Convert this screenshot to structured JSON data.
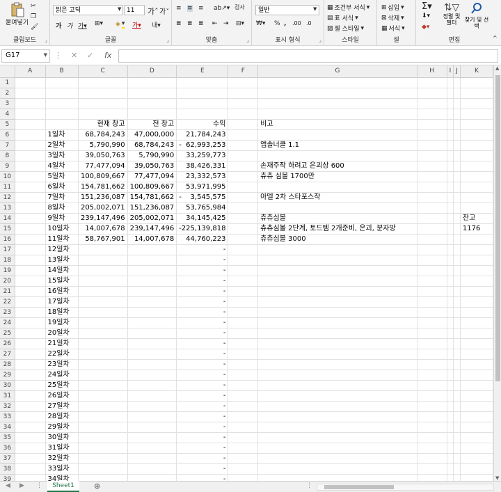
{
  "ribbon": {
    "clipboard": {
      "paste": "붙여넣기",
      "label": "클립보드"
    },
    "font": {
      "name": "맑은 고딕",
      "size": "11",
      "label": "글꼴"
    },
    "alignment": {
      "label": "맞춤",
      "wrap": "검사"
    },
    "number": {
      "format": "일반",
      "label": "표시 형식"
    },
    "styles": {
      "conditional": "조건부 서식",
      "table": "표 서식",
      "cell": "셀 스타일",
      "label": "스타일"
    },
    "cells": {
      "insert": "삽입",
      "delete": "삭제",
      "format": "서식",
      "label": "셀"
    },
    "editing": {
      "sort_filter": "정렬 및 필터",
      "find_select": "찾기 및 선택",
      "label": "편집"
    }
  },
  "formula_bar": {
    "name_box": "G17",
    "formula": ""
  },
  "columns": [
    "A",
    "B",
    "C",
    "D",
    "E",
    "F",
    "G",
    "H",
    "I",
    "J",
    "K"
  ],
  "rows": [
    {
      "n": "1"
    },
    {
      "n": "2"
    },
    {
      "n": "3"
    },
    {
      "n": "4"
    },
    {
      "n": "5",
      "c": "현재 창고",
      "d": "전 창고",
      "e": "수익",
      "g": "비고"
    },
    {
      "n": "6",
      "b": "1일차",
      "c": "68,784,243",
      "d": "47,000,000",
      "e": "21,784,243"
    },
    {
      "n": "7",
      "b": "2일차",
      "c": "5,790,990",
      "d": "68,784,243",
      "e_neg": "-",
      "e": "62,993,253",
      "g": "앱솔너클 1.1"
    },
    {
      "n": "8",
      "b": "3일차",
      "c": "39,050,763",
      "d": "5,790,990",
      "e": "33,259,773"
    },
    {
      "n": "9",
      "b": "4일차",
      "c": "77,477,094",
      "d": "39,050,763",
      "e": "38,426,331",
      "g": "손재주작 하려고 은괴상 600"
    },
    {
      "n": "10",
      "b": "5일차",
      "c": "100,809,667",
      "d": "77,477,094",
      "e": "23,332,573",
      "g": "츄츄 심볼 1700만"
    },
    {
      "n": "11",
      "b": "6일차",
      "c": "154,781,662",
      "d": "100,809,667",
      "e": "53,971,995"
    },
    {
      "n": "12",
      "b": "7일차",
      "c": "151,236,087",
      "d": "154,781,662",
      "e_neg": "-",
      "e": "3,545,575",
      "g": "아델 2차 스타포스작"
    },
    {
      "n": "13",
      "b": "8일차",
      "c": "205,002,071",
      "d": "151,236,087",
      "e": "53,765,984"
    },
    {
      "n": "14",
      "b": "9일차",
      "c": "239,147,496",
      "d": "205,002,071",
      "e": "34,145,425",
      "g": "츄츄심볼",
      "k": "잔고"
    },
    {
      "n": "15",
      "b": "10일차",
      "c": "14,007,678",
      "d": "239,147,496",
      "e": "-225,139,818",
      "g": "츄츄심볼 2단계, 토드템 2개준비, 은괴, 분자망",
      "k": "1176"
    },
    {
      "n": "16",
      "b": "11일차",
      "c": "58,767,901",
      "d": "14,007,678",
      "e": "44,760,223",
      "g": "츄츄심볼 3000"
    },
    {
      "n": "17",
      "b": "12일차",
      "e": "-"
    },
    {
      "n": "18",
      "b": "13일차",
      "e": "-"
    },
    {
      "n": "19",
      "b": "14일차",
      "e": "-"
    },
    {
      "n": "20",
      "b": "15일차",
      "e": "-"
    },
    {
      "n": "21",
      "b": "16일차",
      "e": "-"
    },
    {
      "n": "22",
      "b": "17일차",
      "e": "-"
    },
    {
      "n": "23",
      "b": "18일차",
      "e": "-"
    },
    {
      "n": "24",
      "b": "19일차",
      "e": "-"
    },
    {
      "n": "25",
      "b": "20일차",
      "e": "-"
    },
    {
      "n": "26",
      "b": "21일차",
      "e": "-"
    },
    {
      "n": "27",
      "b": "22일차",
      "e": "-"
    },
    {
      "n": "28",
      "b": "23일차",
      "e": "-"
    },
    {
      "n": "29",
      "b": "24일차",
      "e": "-"
    },
    {
      "n": "30",
      "b": "25일차",
      "e": "-"
    },
    {
      "n": "31",
      "b": "26일차",
      "e": "-"
    },
    {
      "n": "32",
      "b": "27일차",
      "e": "-"
    },
    {
      "n": "33",
      "b": "28일차",
      "e": "-"
    },
    {
      "n": "34",
      "b": "29일차",
      "e": "-"
    },
    {
      "n": "35",
      "b": "30일차",
      "e": "-"
    },
    {
      "n": "36",
      "b": "31일차",
      "e": "-"
    },
    {
      "n": "37",
      "b": "32일차",
      "e": "-"
    },
    {
      "n": "38",
      "b": "33일차",
      "e": "-"
    },
    {
      "n": "39",
      "b": "34일차",
      "e": "-"
    }
  ],
  "sheet_tab": "Sheet1"
}
